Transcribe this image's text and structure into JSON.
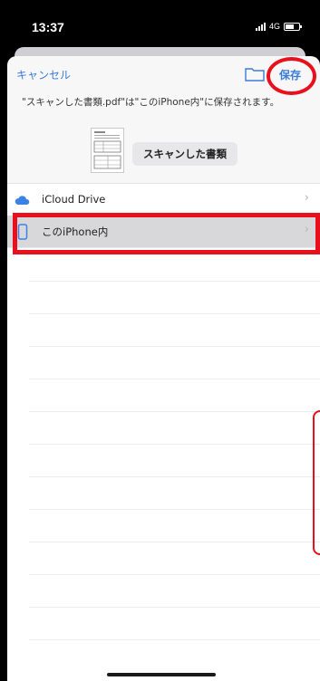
{
  "status_bar": {
    "time": "13:37",
    "network": "4G"
  },
  "nav": {
    "cancel_label": "キャンセル",
    "save_label": "保存",
    "folder_icon": "folder-icon"
  },
  "message": "\"スキャンした書類.pdf\"は\"このiPhone内\"に保存されます。",
  "document": {
    "name": "スキャンした書類"
  },
  "locations": [
    {
      "label": "iCloud Drive",
      "icon": "cloud-icon",
      "selected": false
    },
    {
      "label": "このiPhone内",
      "icon": "iphone-icon",
      "selected": true
    }
  ],
  "colors": {
    "accent": "#3b7bd8",
    "highlight": "#e8101c",
    "selected_row": "#d8d8da"
  }
}
